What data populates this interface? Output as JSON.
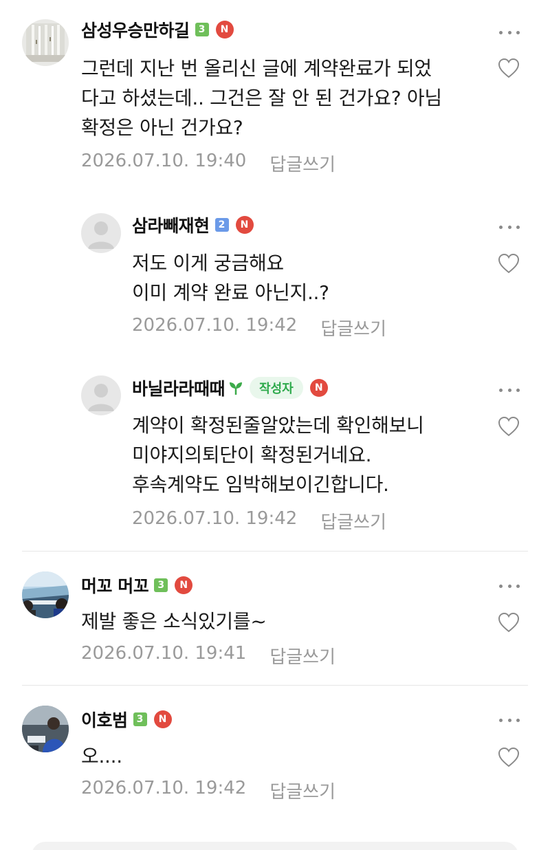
{
  "comments": [
    {
      "nickname": "삼성우승만하길",
      "level": "3",
      "n_badge": "N",
      "lines": [
        "그런데 지난 번 올리신 글에 계약완료가 되었",
        "다고 하셨는데.. 그건은 잘 안 된 건가요? 아님",
        "확정은 아닌 건가요?"
      ],
      "date": "2026.07.10. 19:40",
      "reply_label": "답글쓰기"
    },
    {
      "nickname": "삼라빼재현",
      "level": "2",
      "n_badge": "N",
      "lines": [
        "저도 이게 궁금해요",
        "이미 계약 완료 아닌지..?"
      ],
      "date": "2026.07.10. 19:42",
      "reply_label": "답글쓰기"
    },
    {
      "nickname": "바닐라라때때",
      "author_tag": "작성자",
      "n_badge": "N",
      "lines": [
        "계약이 확정된줄알았는데 확인해보니",
        "미야지의퇴단이 확정된거네요.",
        "후속계약도 임박해보이긴합니다."
      ],
      "date": "2026.07.10. 19:42",
      "reply_label": "답글쓰기"
    },
    {
      "nickname": "머꼬 머꼬",
      "level": "3",
      "n_badge": "N",
      "lines": [
        "제발 좋은 소식있기를~"
      ],
      "date": "2026.07.10. 19:41",
      "reply_label": "답글쓰기"
    },
    {
      "nickname": "이호범",
      "level": "3",
      "n_badge": "N",
      "lines": [
        "오...."
      ],
      "date": "2026.07.10. 19:42",
      "reply_label": "답글쓰기"
    }
  ],
  "icons": {
    "more": "more-dots-icon",
    "like": "heart-outline-icon",
    "sprout": "sprout-icon"
  },
  "colors": {
    "n_badge": "#e24a3f",
    "level_green": "#6fbf5a",
    "level_blue": "#6b9ae8",
    "author_tag_text": "#2eaa4c",
    "author_tag_bg": "#e9f7ec",
    "meta_text": "#9a9a9a"
  }
}
